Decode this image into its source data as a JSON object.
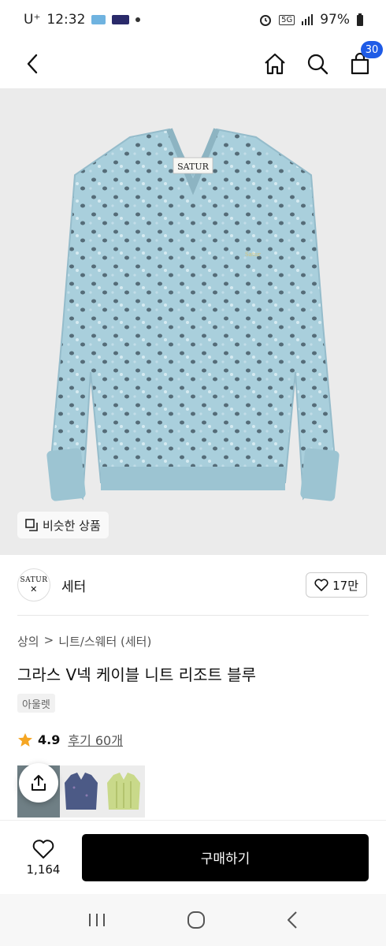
{
  "status_bar": {
    "carrier": "U⁺",
    "time": "12:32",
    "network": "5G",
    "battery": "97%"
  },
  "header": {
    "cart_count": "30"
  },
  "image": {
    "brand_label": "SATUR",
    "similar_label": "비슷한 상품"
  },
  "brand": {
    "logo_text": "SATUR",
    "name": "세터",
    "likes": "17만"
  },
  "product": {
    "breadcrumb": [
      "상의",
      ">",
      "니트/스웨터 (세터)"
    ],
    "title": "그라스 V넥 케이블 니트 리조트 블루",
    "tag": "아울렛",
    "rating": "4.9",
    "reviews": "후기 60개"
  },
  "colors": {
    "accent": "#1e5be6",
    "sweater_blue": "#a9cfdc",
    "thumb_navy": "#4c5a86",
    "thumb_lime": "#c9d98a"
  },
  "bottom": {
    "wish_count": "1,164",
    "buy_label": "구매하기"
  }
}
